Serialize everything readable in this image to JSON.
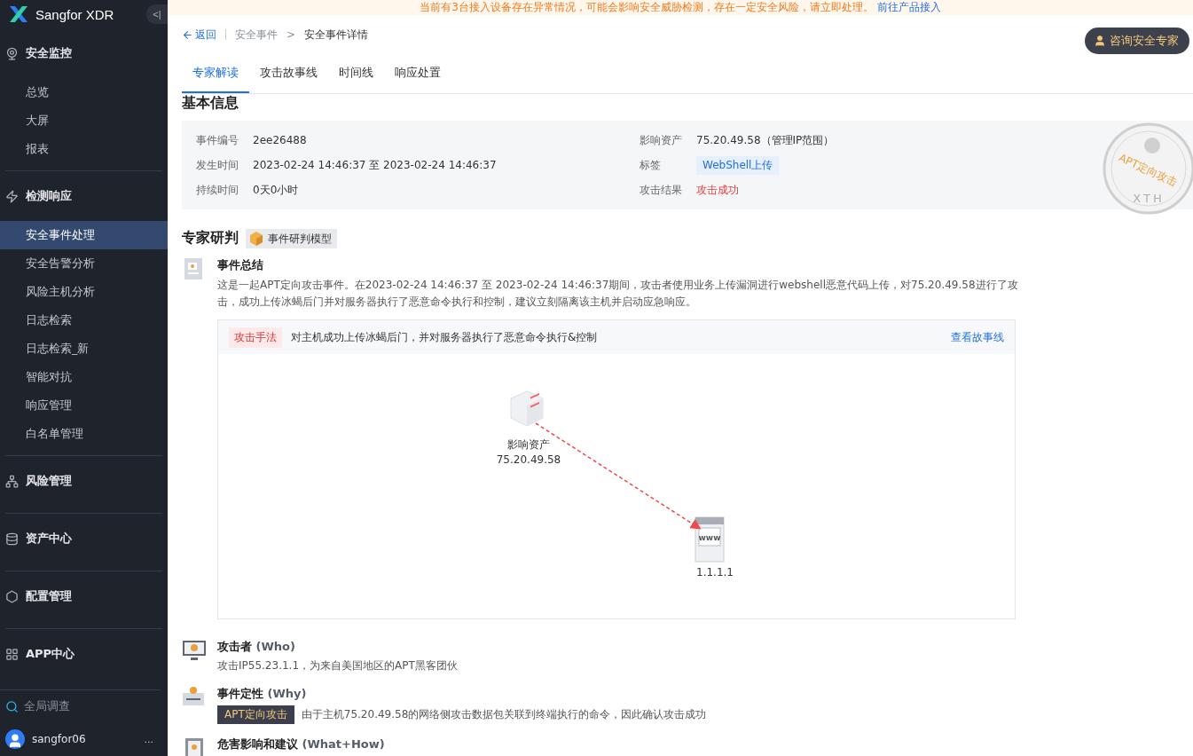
{
  "banner": {
    "message": "当前有3台接入设备存在异常情况，可能会影响安全威胁检测，存在一定安全风险，请立即处理。",
    "link": "前往产品接入"
  },
  "sidebar": {
    "brand": "Sangfor XDR",
    "collapse": "<|",
    "groups": [
      {
        "label": "安全监控",
        "items": [
          {
            "label": "总览",
            "selected": false
          },
          {
            "label": "大屏",
            "selected": false
          },
          {
            "label": "报表",
            "selected": false
          }
        ]
      },
      {
        "label": "检测响应",
        "items": [
          {
            "label": "安全事件处理",
            "selected": true
          },
          {
            "label": "安全告警分析",
            "selected": false
          },
          {
            "label": "风险主机分析",
            "selected": false
          },
          {
            "label": "日志检索",
            "selected": false
          },
          {
            "label": "日志检索_新",
            "selected": false
          },
          {
            "label": "智能对抗",
            "selected": false
          },
          {
            "label": "响应管理",
            "selected": false
          },
          {
            "label": "白名单管理",
            "selected": false
          }
        ]
      },
      {
        "label": "风险管理"
      },
      {
        "label": "资产中心"
      },
      {
        "label": "配置管理"
      },
      {
        "label": "APP中心"
      }
    ],
    "search": "全局调查",
    "user": "sangfor06",
    "more": "..."
  },
  "breadcrumb": {
    "back": "返回",
    "items": [
      "安全事件",
      "安全事件详情"
    ],
    "separator": ">"
  },
  "consult_button": "咨询安全专家",
  "tabs": [
    {
      "label": "专家解读",
      "selected": true
    },
    {
      "label": "攻击故事线",
      "selected": false
    },
    {
      "label": "时间线",
      "selected": false
    },
    {
      "label": "响应处置",
      "selected": false
    }
  ],
  "basic_info": {
    "title": "基本信息",
    "fields": [
      {
        "label": "事件编号",
        "value": "2ee26488",
        "kind": "text"
      },
      {
        "label": "影响资产",
        "value": "75.20.49.58（管理IP范围）",
        "kind": "text"
      },
      {
        "label": "发生时间",
        "value": "2023-02-24 14:46:37 至 2023-02-24 14:46:37",
        "kind": "text"
      },
      {
        "label": "标签",
        "value": "WebShell上传",
        "kind": "tag"
      },
      {
        "label": "持续时间",
        "value": "0天0小时",
        "kind": "text"
      },
      {
        "label": "攻击结果",
        "value": "攻击成功",
        "kind": "danger"
      }
    ],
    "stamp": {
      "text": "APT定向攻击",
      "code": "XTH"
    }
  },
  "expert": {
    "title": "专家研判",
    "model_tag": "事件研判模型",
    "summary": {
      "title": "事件总结",
      "text": "这是一起APT定向攻击事件。在2023-02-24 14:46:37 至 2023-02-24 14:46:37期间，攻击者使用业务上传漏洞进行webshell恶意代码上传，对75.20.49.58进行了攻击，成功上传冰蝎后门并对服务器执行了恶意命令执行和控制，建议立刻隔离该主机并启动应急响应。"
    },
    "method": {
      "tag": "攻击手法",
      "text": "对主机成功上传冰蝎后门，并对服务器执行了恶意命令执行&控制",
      "link": "查看故事线"
    },
    "graph": {
      "nodes": [
        {
          "kind": "server",
          "label": "影响资产",
          "ip": "75.20.49.58"
        },
        {
          "kind": "website",
          "icon_text": "www",
          "ip": "1.1.1.1"
        }
      ]
    },
    "sections": [
      {
        "kind": "who",
        "title": "攻击者",
        "subtitle": "(Who)",
        "text": "攻击IP55.23.1.1，为来自美国地区的APT黑客团伙"
      },
      {
        "kind": "why",
        "title": "事件定性",
        "subtitle": "(Why)",
        "tag": "APT定向攻击",
        "text": "由于主机75.20.49.58的网络侧攻击数据包关联到终端执行的命令，因此确认攻击成功"
      },
      {
        "kind": "how",
        "title": "危害影响和建议",
        "subtitle": "(What+How)"
      }
    ]
  }
}
